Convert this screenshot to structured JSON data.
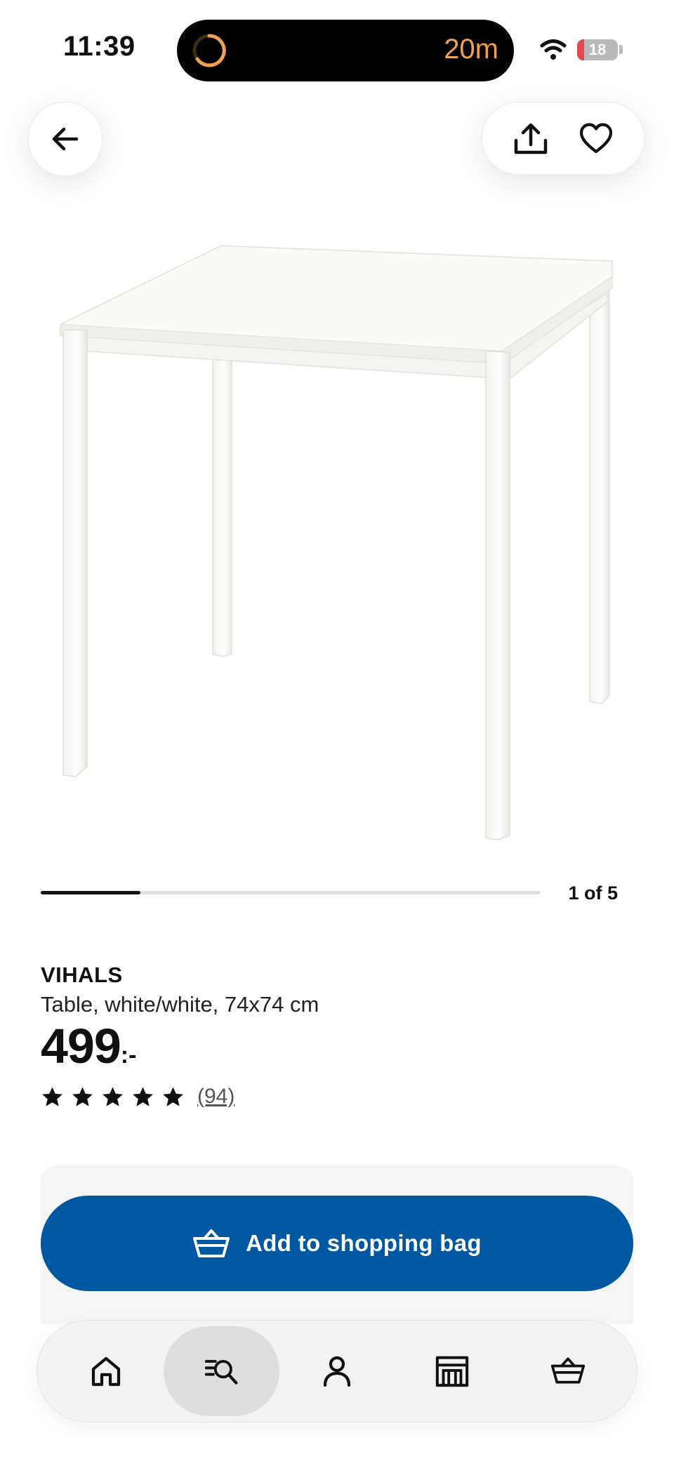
{
  "status_bar": {
    "time": "11:39",
    "timer": "20m",
    "battery_level": "18",
    "battery_fraction": 0.18,
    "accent_color": "#f0a050"
  },
  "header": {
    "back_icon": "arrow-left-icon",
    "share_icon": "share-icon",
    "favorite_icon": "heart-icon"
  },
  "gallery": {
    "current_index": 1,
    "total": 5,
    "page_label": "1 of 5",
    "progress_fraction": 0.2
  },
  "product": {
    "name": "VIHALS",
    "description": "Table, white/white, 74x74 cm",
    "price": "499",
    "price_suffix": ":-",
    "rating": 5,
    "rating_max": 5,
    "review_count": "(94)"
  },
  "cta": {
    "label": "Add to shopping bag",
    "icon": "shopping-basket-icon",
    "color": "#0058a3"
  },
  "bottom_nav": {
    "items": [
      {
        "name": "home",
        "icon": "home-icon",
        "active": false
      },
      {
        "name": "search",
        "icon": "search-list-icon",
        "active": true
      },
      {
        "name": "account",
        "icon": "person-icon",
        "active": false
      },
      {
        "name": "stores",
        "icon": "store-icon",
        "active": false
      },
      {
        "name": "bag",
        "icon": "shopping-basket-icon",
        "active": false
      }
    ]
  }
}
